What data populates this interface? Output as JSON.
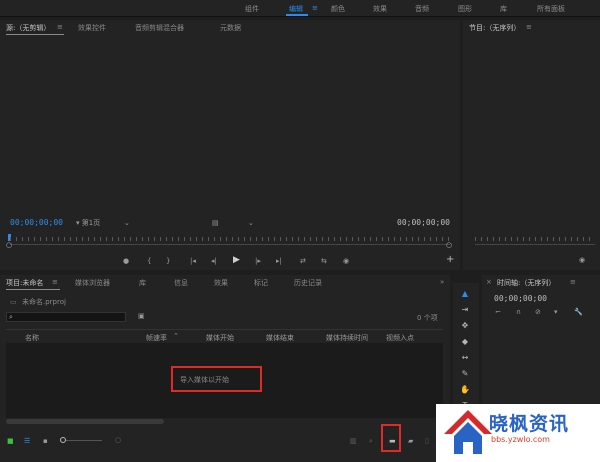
{
  "workspaces": [
    "组件",
    "编辑",
    "颜色",
    "效果",
    "音频",
    "图形",
    "库",
    "所有面板"
  ],
  "workspace_menu": "≡",
  "source_panel": {
    "tabs": [
      "源:（无剪辑）",
      "效果控件",
      "音频剪辑混合器",
      "元数据"
    ],
    "tab_menu": "≡",
    "timecode_left": "00;00;00;00",
    "page_select": "第1页",
    "timecode_right": "00;00;00;00"
  },
  "program_panel": {
    "title": "节目:（无序列）",
    "tab_menu": "≡"
  },
  "transport_icons": [
    "●",
    "{",
    "}",
    "|◂",
    "◂|",
    "▶",
    "|▸",
    "▸|",
    "⇄",
    "⇆",
    "◉"
  ],
  "project_panel": {
    "tabs": [
      "项目:未命名",
      "媒体浏览器",
      "库",
      "信息",
      "效果",
      "标记",
      "历史记录"
    ],
    "tab_menu": "≡",
    "more": "»",
    "project_file": "未命名.prproj",
    "search_placeholder": "",
    "item_count": "0 个项",
    "columns": [
      "名称",
      "帧速率",
      "媒体开始",
      "媒体结束",
      "媒体持续时间",
      "视频入点"
    ],
    "empty_message": "导入媒体以开始"
  },
  "timeline_panel": {
    "title": "时间轴:（无序列）",
    "tab_menu": "≡",
    "timecode": "00;00;00;00"
  },
  "watermark": {
    "text": "晓枫资讯",
    "url": "bbs.yzwlo.com"
  },
  "colors": {
    "accent": "#2d8ceb",
    "highlight": "#e02a2a",
    "panel": "#232323",
    "background": "#1e1e1e"
  }
}
